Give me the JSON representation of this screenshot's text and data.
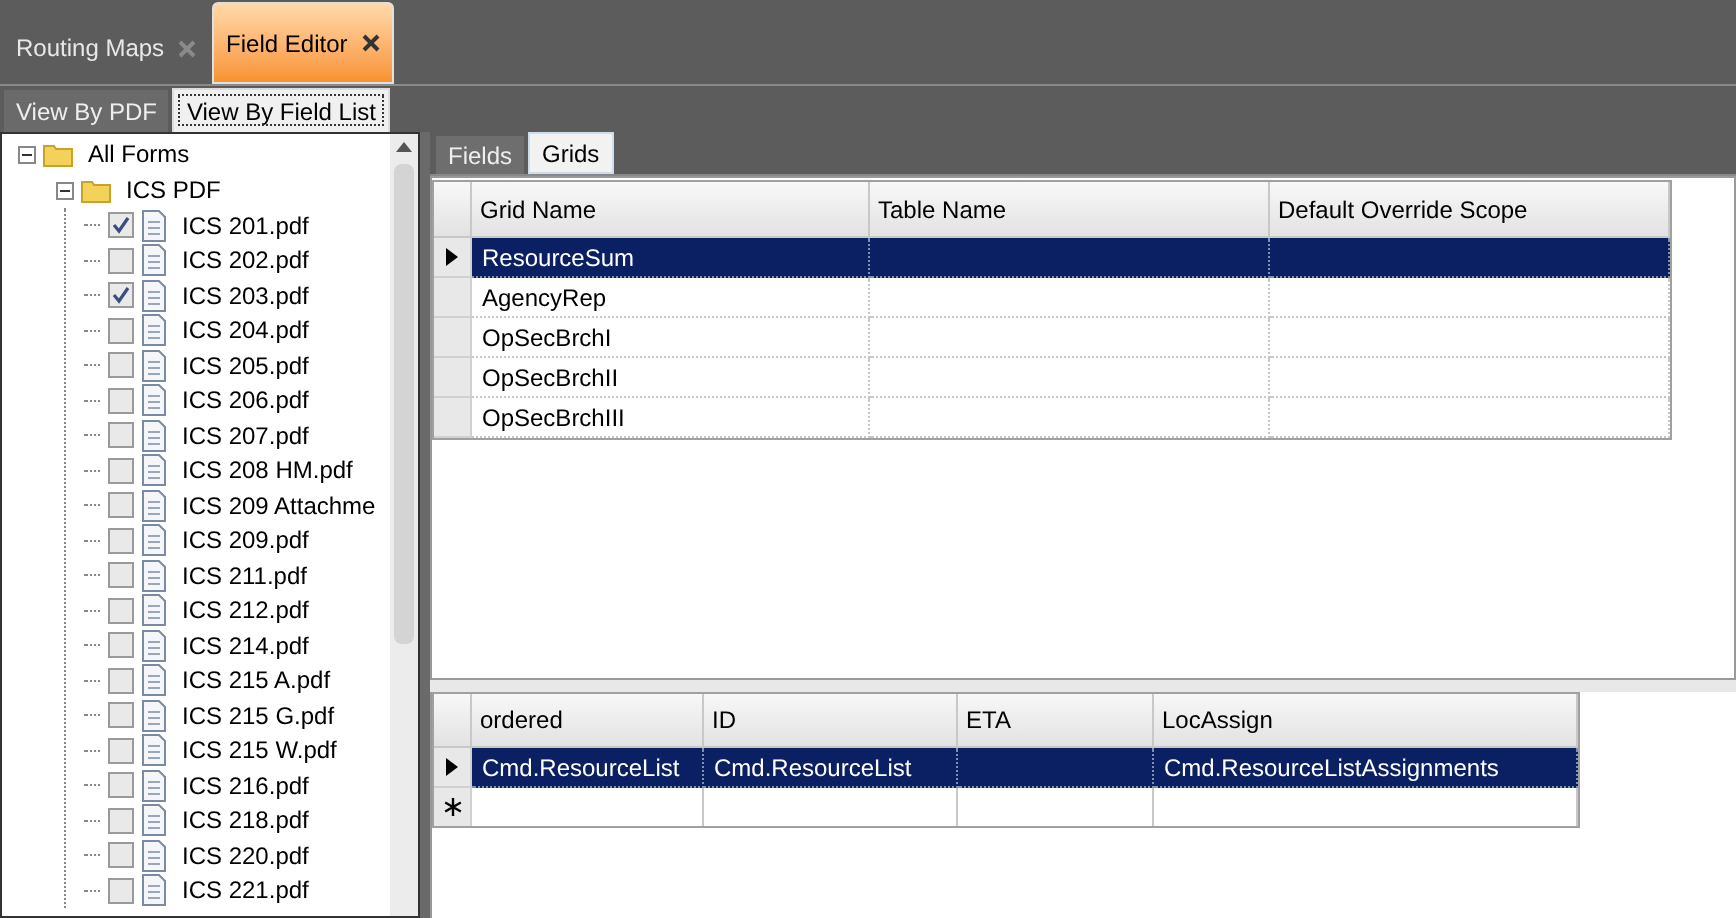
{
  "top_tabs": [
    {
      "label": "Routing Maps",
      "selected": false
    },
    {
      "label": "Field Editor",
      "selected": true
    }
  ],
  "view_tabs": [
    {
      "label": "View By PDF",
      "selected": false
    },
    {
      "label": "View By Field List",
      "selected": true
    }
  ],
  "tree": [
    {
      "label": "All Forms",
      "expanded": true,
      "children": [
        {
          "label": "ICS PDF",
          "expanded": true,
          "children": [
            {
              "label": "ICS 201.pdf",
              "checked": true
            },
            {
              "label": "ICS 202.pdf",
              "checked": false
            },
            {
              "label": "ICS 203.pdf",
              "checked": true
            },
            {
              "label": "ICS 204.pdf",
              "checked": false
            },
            {
              "label": "ICS 205.pdf",
              "checked": false
            },
            {
              "label": "ICS 206.pdf",
              "checked": false
            },
            {
              "label": "ICS 207.pdf",
              "checked": false
            },
            {
              "label": "ICS 208 HM.pdf",
              "checked": false
            },
            {
              "label": "ICS 209 Attachme",
              "checked": false
            },
            {
              "label": "ICS 209.pdf",
              "checked": false
            },
            {
              "label": "ICS 211.pdf",
              "checked": false
            },
            {
              "label": "ICS 212.pdf",
              "checked": false
            },
            {
              "label": "ICS 214.pdf",
              "checked": false
            },
            {
              "label": "ICS 215 A.pdf",
              "checked": false
            },
            {
              "label": "ICS 215 G.pdf",
              "checked": false
            },
            {
              "label": "ICS 215 W.pdf",
              "checked": false
            },
            {
              "label": "ICS 216.pdf",
              "checked": false
            },
            {
              "label": "ICS 218.pdf",
              "checked": false
            },
            {
              "label": "ICS 220.pdf",
              "checked": false
            },
            {
              "label": "ICS 221.pdf",
              "checked": false
            }
          ]
        }
      ]
    }
  ],
  "inner_tabs": [
    {
      "label": "Fields",
      "selected": false
    },
    {
      "label": "Grids",
      "selected": true
    }
  ],
  "grids_table": {
    "columns": [
      "Grid Name",
      "Table Name",
      "Default Override Scope"
    ],
    "rows": [
      {
        "selected": true,
        "cells": [
          "ResourceSum",
          "",
          ""
        ]
      },
      {
        "selected": false,
        "cells": [
          "AgencyRep",
          "",
          ""
        ]
      },
      {
        "selected": false,
        "cells": [
          "OpSecBrchI",
          "",
          ""
        ]
      },
      {
        "selected": false,
        "cells": [
          "OpSecBrchII",
          "",
          ""
        ]
      },
      {
        "selected": false,
        "cells": [
          "OpSecBrchIII",
          "",
          ""
        ]
      }
    ]
  },
  "detail_table": {
    "columns": [
      "ordered",
      "ID",
      "ETA",
      "LocAssign"
    ],
    "rows": [
      {
        "selected": true,
        "cells": [
          "Cmd.ResourceList",
          "Cmd.ResourceList",
          "",
          "Cmd.ResourceListAssignments"
        ]
      }
    ],
    "new_row": true
  }
}
